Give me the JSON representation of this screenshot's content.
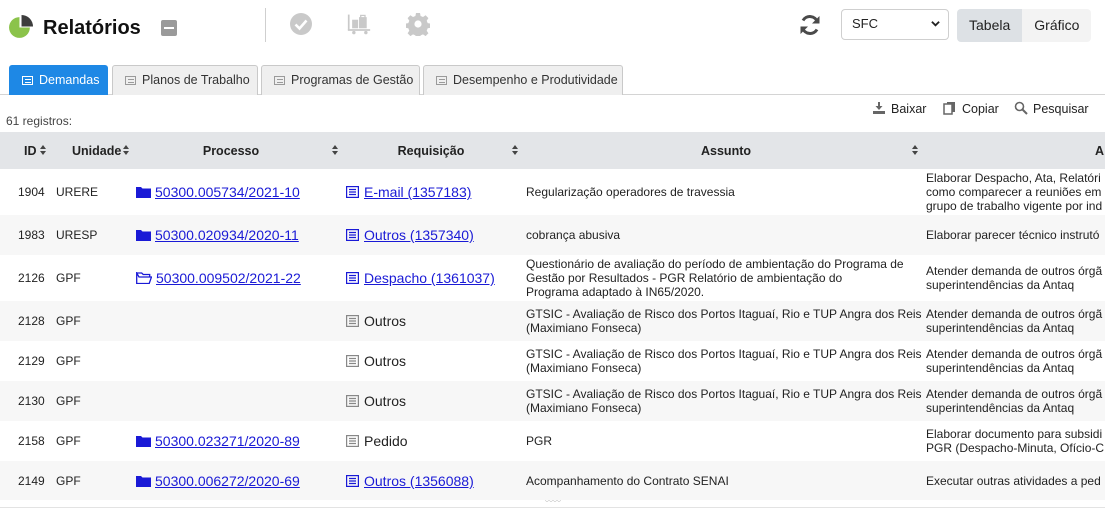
{
  "header": {
    "title": "Relatórios",
    "select_value": "SFC",
    "view_toggle": [
      "Tabela",
      "Gráfico"
    ]
  },
  "tabs": [
    {
      "label": "Demandas",
      "active": true
    },
    {
      "label": "Planos de Trabalho"
    },
    {
      "label": "Programas de Gestão"
    },
    {
      "label": "Desempenho e Produtividade"
    }
  ],
  "records": "61 registros:",
  "actions": [
    "Baixar",
    "Copiar",
    "Pesquisar"
  ],
  "table": {
    "columns": [
      "ID",
      "Unidade",
      "Processo",
      "Requisição",
      "Assunto",
      "A"
    ],
    "rows": [
      {
        "id": "1904",
        "unit": "URERE",
        "process": "50300.005734/2021-10",
        "folder": "closed",
        "req": "E-mail (1357183)",
        "req_link": true,
        "subject": [
          "Regularização operadores de travessia"
        ],
        "desc": [
          "Elaborar Despacho, Ata, Relatóri",
          "como comparecer a reuniões em",
          "grupo de trabalho vigente por ind"
        ]
      },
      {
        "id": "1983",
        "unit": "URESP",
        "process": "50300.020934/2020-11",
        "folder": "closed",
        "req": "Outros (1357340)",
        "req_link": true,
        "subject": [
          "cobrança abusiva"
        ],
        "desc": [
          "Elaborar parecer técnico instrutó"
        ]
      },
      {
        "id": "2126",
        "unit": "GPF",
        "process": "50300.009502/2021-22",
        "folder": "open",
        "req": "Despacho (1361037)",
        "req_link": true,
        "subject": [
          "Questionário de avaliação do período de ambientação do Programa de",
          "Gestão por Resultados - PGR  Relatório de ambientação do",
          "Programa adaptado à IN65/2020."
        ],
        "desc": [
          "Atender demanda de outros órgã",
          "superintendências da Antaq"
        ]
      },
      {
        "id": "2128",
        "unit": "GPF",
        "process": "",
        "folder": "",
        "req": "Outros",
        "req_link": false,
        "subject": [
          "GTSIC - Avaliação de Risco dos Portos Itaguaí, Rio e TUP Angra dos Reis",
          "(Maximiano Fonseca)"
        ],
        "desc": [
          "Atender demanda de outros órgã",
          "superintendências da Antaq"
        ]
      },
      {
        "id": "2129",
        "unit": "GPF",
        "process": "",
        "folder": "",
        "req": "Outros",
        "req_link": false,
        "subject": [
          "GTSIC - Avaliação de Risco dos Portos Itaguaí, Rio e TUP Angra dos Reis",
          "(Maximiano Fonseca)"
        ],
        "desc": [
          "Atender demanda de outros órgã",
          "superintendências da Antaq"
        ]
      },
      {
        "id": "2130",
        "unit": "GPF",
        "process": "",
        "folder": "",
        "req": "Outros",
        "req_link": false,
        "subject": [
          "GTSIC - Avaliação de Risco dos Portos Itaguaí, Rio e TUP Angra dos Reis",
          "(Maximiano Fonseca)"
        ],
        "desc": [
          "Atender demanda de outros órgã",
          "superintendências da Antaq"
        ]
      },
      {
        "id": "2158",
        "unit": "GPF",
        "process": "50300.023271/2020-89",
        "folder": "closed",
        "req": "Pedido",
        "req_link": false,
        "subject": [
          "PGR"
        ],
        "desc": [
          "Elaborar documento para subsidi",
          "PGR (Despacho-Minuta, Ofício-C"
        ]
      },
      {
        "id": "2149",
        "unit": "GPF",
        "process": "50300.006272/2020-69",
        "folder": "closed",
        "req": "Outros (1356088)",
        "req_link": true,
        "subject": [
          "Acompanhamento do Contrato SENAI"
        ],
        "desc": [
          "Executar outras atividades a ped"
        ]
      }
    ]
  },
  "colors": {
    "accent": "#1e88e5",
    "link": "#1a1ad6",
    "logo_green": "#8bc34a"
  }
}
